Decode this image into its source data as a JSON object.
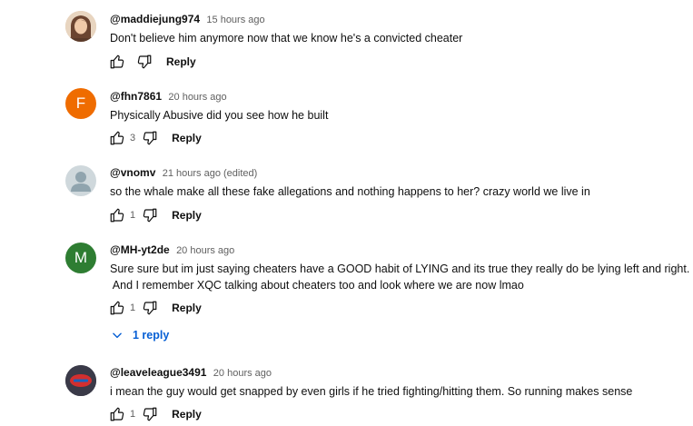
{
  "comments": [
    {
      "handle": "@maddiejung974",
      "time": "15 hours ago",
      "text": "Don't believe him anymore now that we know he's a convicted cheater",
      "likes": "",
      "reply_label": "Reply",
      "avatar": {
        "type": "photo",
        "letter": "",
        "color": "#c9a27e"
      }
    },
    {
      "handle": "@fhn7861",
      "time": "20 hours ago",
      "text": "Physically Abusive did you see how he built",
      "likes": "3",
      "reply_label": "Reply",
      "avatar": {
        "type": "letter",
        "letter": "F",
        "color": "#ef6c00"
      }
    },
    {
      "handle": "@vnomv",
      "time": "21 hours ago (edited)",
      "text": "so the whale make all these fake allegations and nothing happens to her? crazy world we live in",
      "likes": "1",
      "reply_label": "Reply",
      "avatar": {
        "type": "default",
        "letter": "",
        "color": "#cfd8dc"
      }
    },
    {
      "handle": "@MH-yt2de",
      "time": "20 hours ago",
      "text": "Sure sure but im just saying cheaters have a GOOD habit of LYING and its true they really do be lying left and right.",
      "text2": " And I remember XQC talking about cheaters too and look where we are now lmao",
      "likes": "1",
      "reply_label": "Reply",
      "replies_label": "1 reply",
      "avatar": {
        "type": "letter",
        "letter": "M",
        "color": "#2e7d32"
      }
    },
    {
      "handle": "@leaveleague3491",
      "time": "20 hours ago",
      "text": "i mean the guy would get snapped by even girls if he tried fighting/hitting them. So running makes sense",
      "likes": "1",
      "reply_label": "Reply",
      "avatar": {
        "type": "logo",
        "letter": "",
        "color": "#e53935"
      }
    }
  ]
}
